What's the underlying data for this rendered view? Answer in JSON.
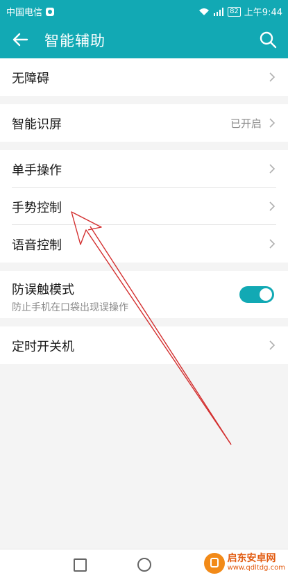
{
  "status_bar": {
    "carrier": "中国电信",
    "battery": "82",
    "time": "上午9:44"
  },
  "header": {
    "title": "智能辅助"
  },
  "settings": {
    "accessibility": {
      "label": "无障碍"
    },
    "smart_screen": {
      "label": "智能识屏",
      "value": "已开启"
    },
    "one_hand": {
      "label": "单手操作"
    },
    "gesture": {
      "label": "手势控制"
    },
    "voice": {
      "label": "语音控制"
    },
    "mistouch": {
      "label": "防误触模式",
      "description": "防止手机在口袋出现误操作",
      "enabled": true
    },
    "power_schedule": {
      "label": "定时开关机"
    }
  },
  "watermark": {
    "name": "启东安卓网",
    "url": "www.qdltdg.com"
  },
  "colors": {
    "accent": "#12a9b4",
    "annotation_arrow": "#d32f2f"
  }
}
